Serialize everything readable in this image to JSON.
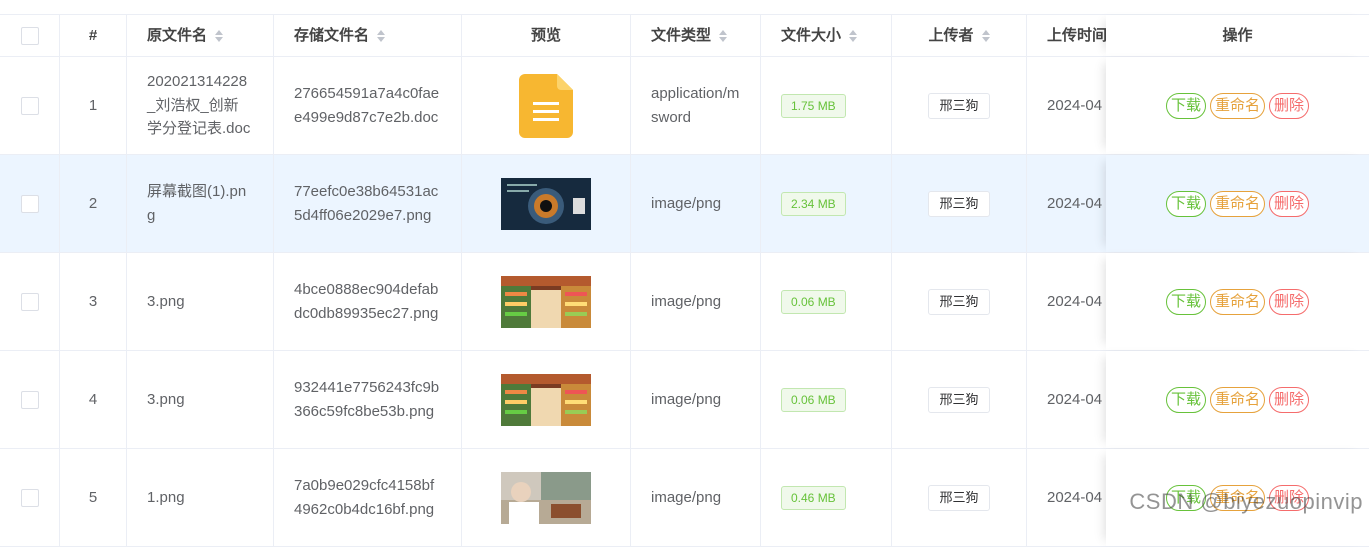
{
  "table": {
    "headers": {
      "index": "#",
      "original_name": "原文件名",
      "stored_name": "存储文件名",
      "preview": "预览",
      "file_type": "文件类型",
      "file_size": "文件大小",
      "uploader": "上传者",
      "upload_time": "上传时间",
      "actions": "操作"
    },
    "rows": [
      {
        "index": "1",
        "original_name": "202021314228_刘浩权_创新学分登记表.doc",
        "stored_name": "276654591a7a4c0faee499e9d87c7e2b.doc",
        "preview_icon": "doc-file-icon",
        "file_type": "application/msword",
        "file_size": "1.75 MB",
        "uploader": "邢三狗",
        "upload_time": "2024-04",
        "highlighted": false
      },
      {
        "index": "2",
        "original_name": "屏幕截图(1).png",
        "stored_name": "77eefc0e38b64531ac5d4ff06e2029e7.png",
        "preview_icon": "screenshot-thumbnail",
        "file_type": "image/png",
        "file_size": "2.34 MB",
        "uploader": "邢三狗",
        "upload_time": "2024-04",
        "highlighted": true
      },
      {
        "index": "3",
        "original_name": "3.png",
        "stored_name": "4bce0888ec904defabdc0db89935ec27.png",
        "preview_icon": "supermarket-thumbnail",
        "file_type": "image/png",
        "file_size": "0.06 MB",
        "uploader": "邢三狗",
        "upload_time": "2024-04",
        "highlighted": false
      },
      {
        "index": "4",
        "original_name": "3.png",
        "stored_name": "932441e7756243fc9b366c59fc8be53b.png",
        "preview_icon": "supermarket-thumbnail",
        "file_type": "image/png",
        "file_size": "0.06 MB",
        "uploader": "邢三狗",
        "upload_time": "2024-04",
        "highlighted": false
      },
      {
        "index": "5",
        "original_name": "1.png",
        "stored_name": "7a0b9e029cfc4158bf4962c0b4dc16bf.png",
        "preview_icon": "shopping-thumbnail",
        "file_type": "image/png",
        "file_size": "0.46 MB",
        "uploader": "邢三狗",
        "upload_time": "2024-04",
        "highlighted": false
      }
    ],
    "actions": {
      "download": "下载",
      "rename": "重命名",
      "delete": "删除"
    }
  },
  "watermark": "CSDN @biyezuopinvip",
  "colors": {
    "success": "#67c23a",
    "warning": "#e6a23c",
    "danger": "#f56c6c",
    "row_highlight": "#ecf5ff",
    "doc_icon": "#f7b731"
  }
}
